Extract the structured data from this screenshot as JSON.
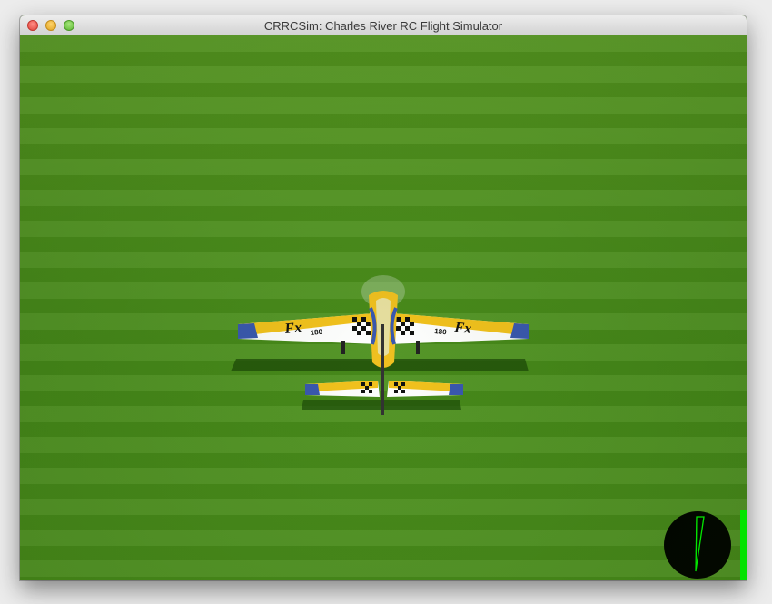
{
  "window": {
    "title": "CRRCSim: Charles River RC Flight Simulator"
  },
  "aircraft": {
    "wing_text_left": "Fx",
    "wing_text_right": "Fx",
    "wing_number_left": "180",
    "wing_number_right": "180"
  },
  "colors": {
    "grass": "#4f931d",
    "compass_bg": "#000000",
    "compass_needle": "#00ff00",
    "throttle_bar": "#00ff00"
  }
}
